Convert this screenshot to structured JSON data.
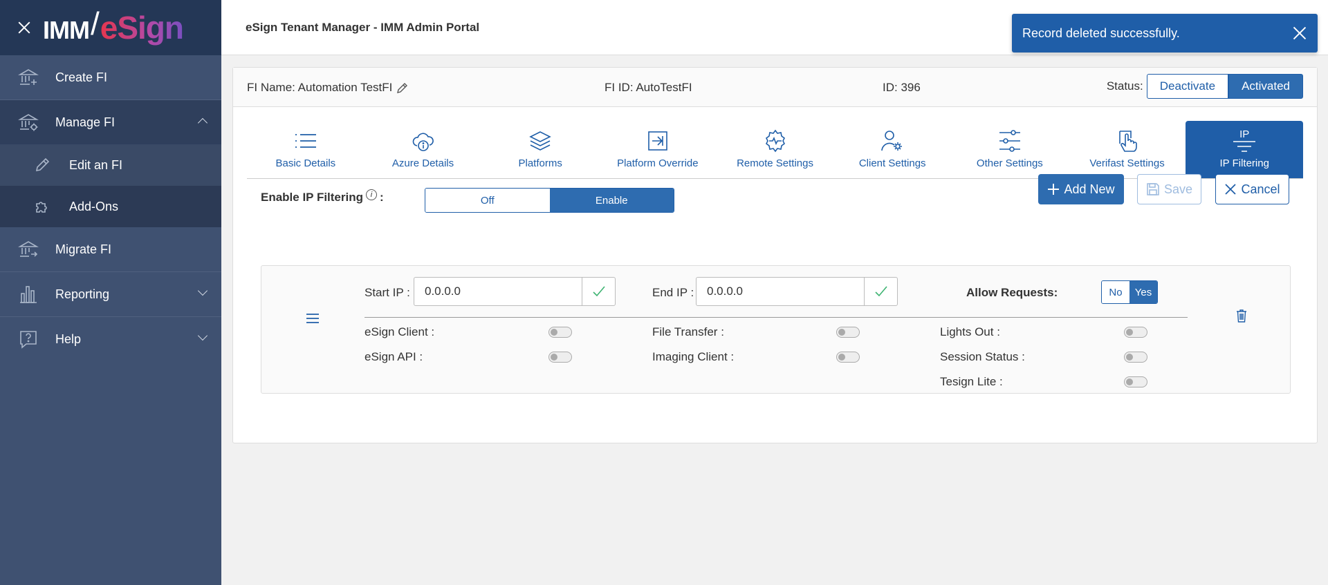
{
  "sidebar": {
    "logo": {
      "imm": "IMM",
      "slash": "/",
      "esign": "eSign"
    },
    "items": [
      {
        "label": "Create FI",
        "icon": "bank-plus-icon"
      },
      {
        "label": "Manage FI",
        "icon": "bank-gear-icon",
        "expanded": true,
        "children": [
          {
            "label": "Edit an FI",
            "icon": "pencil-icon",
            "active": true
          },
          {
            "label": "Add-Ons",
            "icon": "puzzle-icon"
          }
        ]
      },
      {
        "label": "Migrate FI",
        "icon": "bank-arrow-icon"
      },
      {
        "label": "Reporting",
        "icon": "bar-chart-icon",
        "expanded": false
      },
      {
        "label": "Help",
        "icon": "help-chat-icon",
        "expanded": false
      }
    ]
  },
  "header": {
    "title": "eSign Tenant Manager - IMM Admin Portal"
  },
  "toast": {
    "message": "Record deleted successfully.",
    "color": "#1f5ea8"
  },
  "info_bar": {
    "fi_name": "FI Name: Automation TestFI",
    "fi_id": "FI ID: AutoTestFI",
    "id": "ID: 396",
    "status_label": "Status:",
    "deactivate_label": "Deactivate",
    "activated_label": "Activated"
  },
  "tabs": [
    {
      "label": "Basic Details",
      "icon": "list-icon"
    },
    {
      "label": "Azure Details",
      "icon": "cloud-info-icon"
    },
    {
      "label": "Platforms",
      "icon": "layers-icon"
    },
    {
      "label": "Platform Override",
      "icon": "arrow-into-box-icon"
    },
    {
      "label": "Remote Settings",
      "icon": "gear-pulse-icon"
    },
    {
      "label": "Client Settings",
      "icon": "user-gear-icon"
    },
    {
      "label": "Other Settings",
      "icon": "sliders-icon"
    },
    {
      "label": "Verifast Settings",
      "icon": "hand-touch-icon"
    },
    {
      "label": "IP Filtering",
      "icon": "ip-filter-icon",
      "icon_text": "IP",
      "active": true
    }
  ],
  "ip_filter": {
    "enable_label": "Enable IP Filtering",
    "enable_colon": ":",
    "info_glyph": "i",
    "off_label": "Off",
    "enable_option": "Enable",
    "enabled": true,
    "add_new_label": "Add New",
    "save_label": "Save",
    "cancel_label": "Cancel",
    "rule": {
      "start_ip_label": "Start IP :",
      "start_ip_value": "0.0.0.0",
      "end_ip_label": "End IP :",
      "end_ip_value": "0.0.0.0",
      "allow_requests_label": "Allow Requests:",
      "no_label": "No",
      "yes_label": "Yes",
      "allow": "Yes",
      "permissions": [
        {
          "label": "eSign Client :",
          "enabled": false
        },
        {
          "label": "File Transfer :",
          "enabled": false
        },
        {
          "label": "Lights Out :",
          "enabled": false
        },
        {
          "label": "eSign API :",
          "enabled": false
        },
        {
          "label": "Imaging Client :",
          "enabled": false
        },
        {
          "label": "Session Status :",
          "enabled": false
        },
        {
          "label": "Tesign Lite :",
          "enabled": false
        }
      ]
    }
  }
}
